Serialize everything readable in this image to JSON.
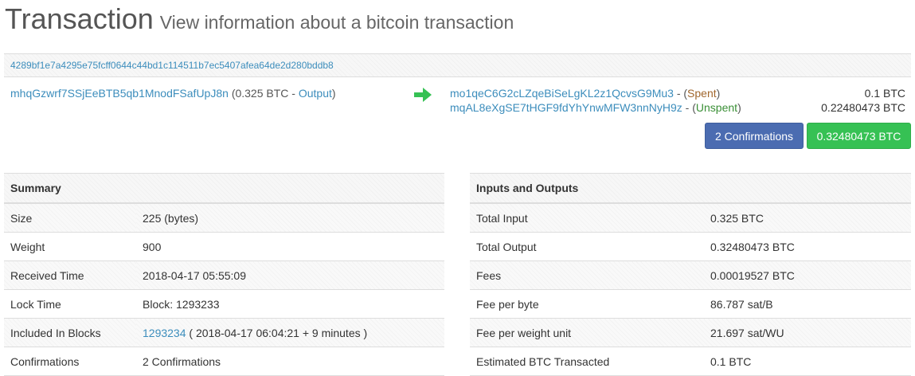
{
  "header": {
    "title": "Transaction",
    "subtitle": "View information about a bitcoin transaction"
  },
  "txid": "4289bf1e7a4295e75fcff0644c44bd1c114511b7ec5407afea64de2d280bddb8",
  "inputs": [
    {
      "address": "mhqGzwrf7SSjEeBTB5qb1MnodFSafUpJ8n",
      "amount": "(0.325 BTC - ",
      "link_label": "Output",
      "close": ")"
    }
  ],
  "arrow_icon": "arrow-right-icon",
  "outputs": [
    {
      "address": "mo1qeC6G2cLZqeBiSeLgKL2z1QcvsG9Mu3",
      "sep": " - (",
      "status": "Spent",
      "close": ")",
      "amount": "0.1 BTC",
      "status_color": "#a0662c"
    },
    {
      "address": "mqAL8eXgSE7tHGF9fdYhYnwMFW3nnNyH9z",
      "sep": " - (",
      "status": "Unspent",
      "close": ")",
      "amount": "0.22480473 BTC",
      "status_color": "#3a8f36"
    }
  ],
  "buttons": {
    "confirmations": "2 Confirmations",
    "total": "0.32480473 BTC"
  },
  "colors": {
    "link": "#3c8dbc",
    "confirm_button": "#4b6cb1",
    "total_button": "#36c154"
  },
  "summary": {
    "title": "Summary",
    "rows": [
      {
        "label": "Size",
        "value": "225 (bytes)"
      },
      {
        "label": "Weight",
        "value": "900"
      },
      {
        "label": "Received Time",
        "value": "2018-04-17 05:55:09"
      },
      {
        "label": "Lock Time",
        "value": "Block: 1293233"
      },
      {
        "label": "Included In Blocks",
        "block_link": "1293234",
        "value": " ( 2018-04-17 06:04:21 + 9 minutes )"
      },
      {
        "label": "Confirmations",
        "value": "2 Confirmations"
      }
    ]
  },
  "io": {
    "title": "Inputs and Outputs",
    "rows": [
      {
        "label": "Total Input",
        "value": "0.325 BTC"
      },
      {
        "label": "Total Output",
        "value": "0.32480473 BTC"
      },
      {
        "label": "Fees",
        "value": "0.00019527 BTC"
      },
      {
        "label": "Fee per byte",
        "value": "86.787 sat/B"
      },
      {
        "label": "Fee per weight unit",
        "value": "21.697 sat/WU"
      },
      {
        "label": "Estimated BTC Transacted",
        "value": "0.1 BTC"
      }
    ]
  }
}
